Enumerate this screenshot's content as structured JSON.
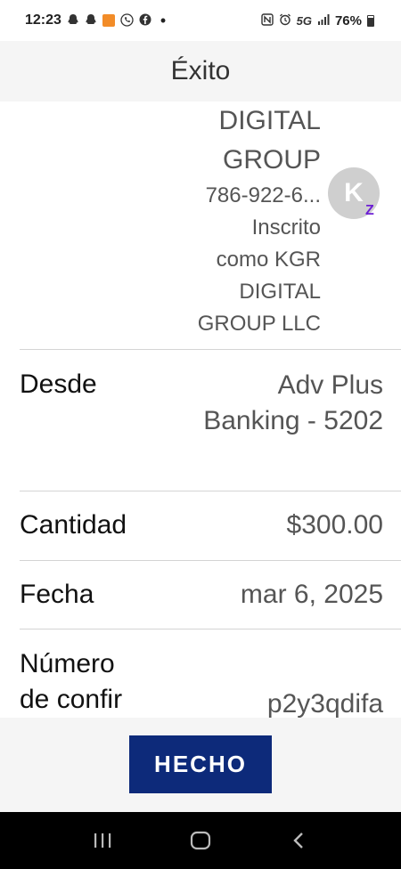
{
  "status_bar": {
    "time": "12:23",
    "network": "5G",
    "battery": "76%"
  },
  "header": {
    "title": "Éxito"
  },
  "payee": {
    "name_lines": [
      "DIGITAL",
      "GROUP"
    ],
    "phone": "786-922-6...",
    "enrolled_lines": [
      "Inscrito",
      "como KGR",
      "DIGITAL",
      "GROUP LLC"
    ],
    "avatar_initial": "K",
    "badge": "Z"
  },
  "details": {
    "from": {
      "label": "Desde",
      "value_lines": [
        "Adv Plus",
        "Banking - 5202"
      ]
    },
    "amount": {
      "label": "Cantidad",
      "value": "$300.00"
    },
    "date": {
      "label": "Fecha",
      "value": "mar 6, 2025"
    },
    "confirmation": {
      "label_lines": [
        "Número",
        "de confir"
      ],
      "value": "p2y3qdifa"
    }
  },
  "footer": {
    "done_label": "HECHO"
  },
  "colors": {
    "primary_button": "#0d2a7a",
    "zelle_purple": "#6d1ed4",
    "header_bg": "#f5f5f5"
  }
}
